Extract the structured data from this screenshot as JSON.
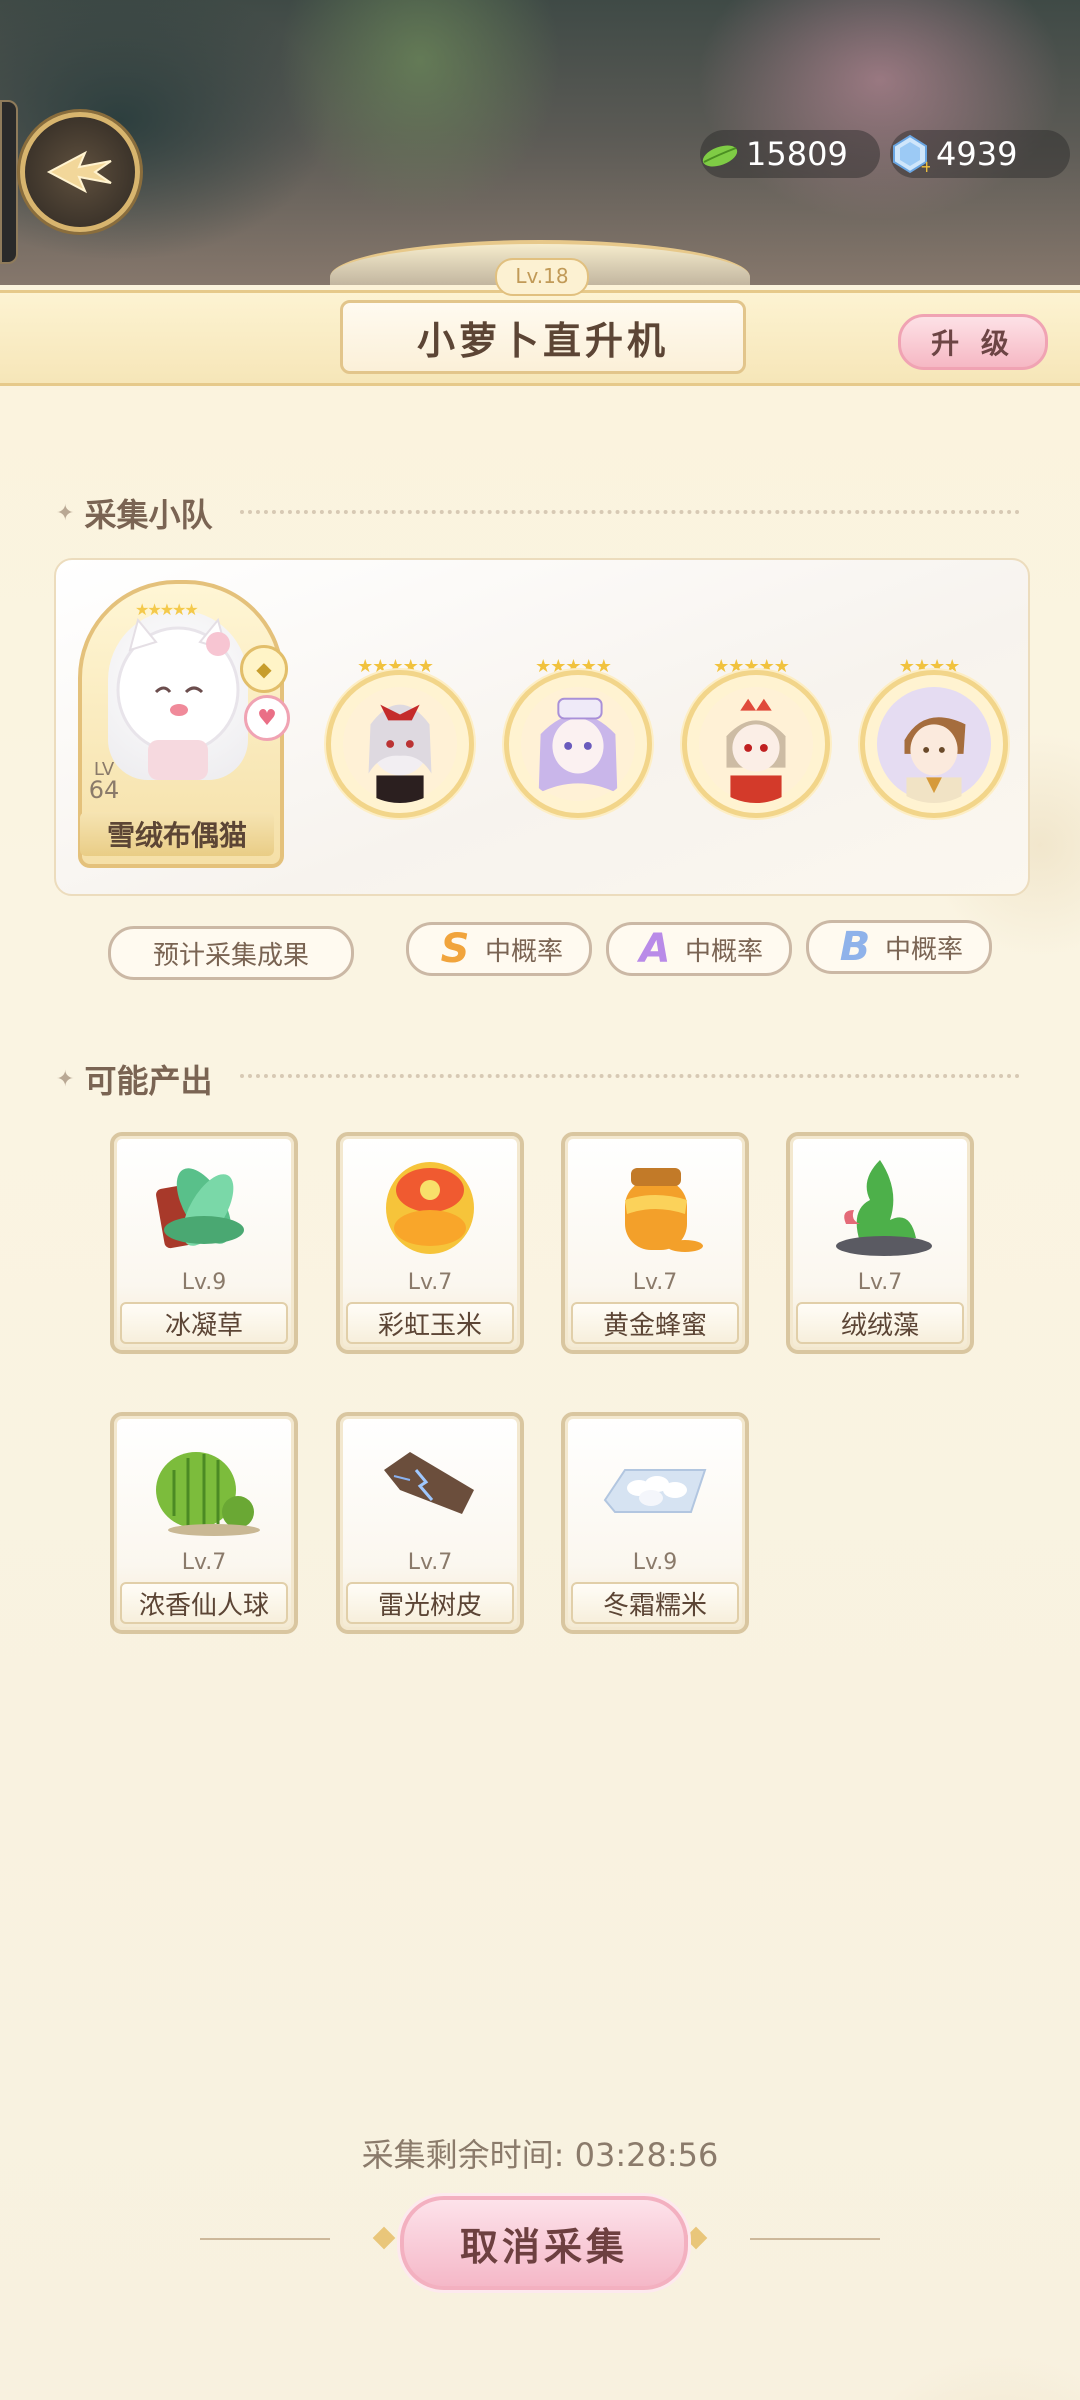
{
  "currency": {
    "leaf": "15809",
    "gem": "4939"
  },
  "header": {
    "level": "Lv.18",
    "title": "小萝卜直升机",
    "upgrade_label": "升 级"
  },
  "team": {
    "section_title": "采集小队",
    "leader": {
      "name": "雪绒布偶猫",
      "lv_label": "LV",
      "level": "64",
      "stars": "★★★★★"
    },
    "members": [
      {
        "stars": "★★★★★"
      },
      {
        "stars": "★★★★★"
      },
      {
        "stars": "★★★★★"
      },
      {
        "stars": "★★★★"
      }
    ],
    "estimate_label": "预计采集成果",
    "rates": [
      {
        "rank": "S",
        "label": "中概率",
        "color": "#f1a43c"
      },
      {
        "rank": "A",
        "label": "中概率",
        "color": "#b98be8"
      },
      {
        "rank": "B",
        "label": "中概率",
        "color": "#8fb2ea"
      }
    ]
  },
  "output": {
    "section_title": "可能产出",
    "items": [
      {
        "level": "Lv.9",
        "name": "冰凝草",
        "icon": "ice-grass-icon"
      },
      {
        "level": "Lv.7",
        "name": "彩虹玉米",
        "icon": "rainbow-corn-icon"
      },
      {
        "level": "Lv.7",
        "name": "黄金蜂蜜",
        "icon": "golden-honey-icon"
      },
      {
        "level": "Lv.7",
        "name": "绒绒藻",
        "icon": "fluffy-algae-icon"
      },
      {
        "level": "Lv.7",
        "name": "浓香仙人球",
        "icon": "cactus-icon"
      },
      {
        "level": "Lv.7",
        "name": "雷光树皮",
        "icon": "thunder-bark-icon"
      },
      {
        "level": "Lv.9",
        "name": "冬霜糯米",
        "icon": "frost-rice-icon"
      }
    ]
  },
  "footer": {
    "timer": "采集剩余时间: 03:28:56",
    "cancel_label": "取消采集"
  }
}
